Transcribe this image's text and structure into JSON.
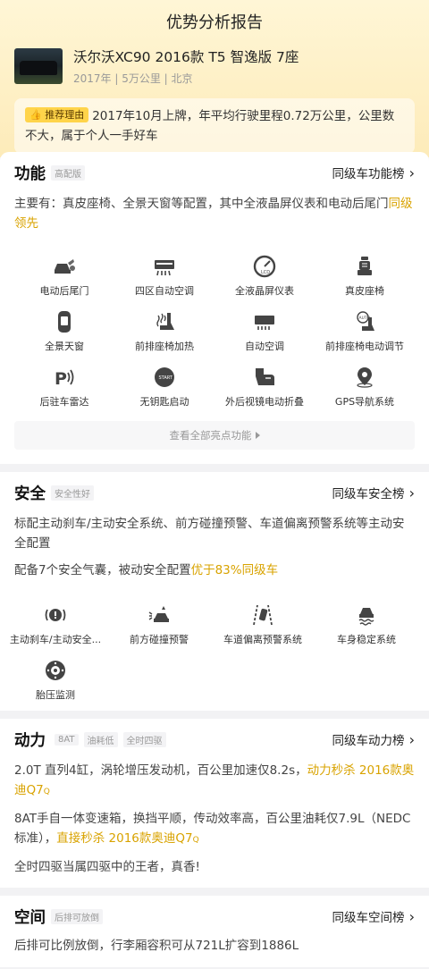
{
  "header": {
    "title": "优势分析报告"
  },
  "car": {
    "name": "沃尔沃XC90 2016款 T5 智逸版 7座",
    "meta": "2017年 | 5万公里 | 北京",
    "reason_tag": "推荐理由",
    "reason_text": "2017年10月上牌，年平均行驶里程0.72万公里，公里数不大，属于个人一手好车"
  },
  "function": {
    "title": "功能",
    "tag": "高配版",
    "link": "同级车功能榜",
    "desc_prefix": "主要有：真皮座椅、全景天窗等配置，其中全液晶屏仪表和电动后尾门",
    "desc_hl": "同级领先",
    "items": [
      {
        "label": "电动后尾门",
        "icon": "tailgate-icon"
      },
      {
        "label": "四区自动空调",
        "icon": "ac-icon"
      },
      {
        "label": "全液晶屏仪表",
        "icon": "lcd-gauge-icon"
      },
      {
        "label": "真皮座椅",
        "icon": "seat-icon"
      },
      {
        "label": "全景天窗",
        "icon": "sunroof-icon"
      },
      {
        "label": "前排座椅加热",
        "icon": "seat-heat-icon"
      },
      {
        "label": "自动空调",
        "icon": "auto-ac-icon"
      },
      {
        "label": "前排座椅电动调节",
        "icon": "auto-seat-icon"
      },
      {
        "label": "后驻车雷达",
        "icon": "parking-radar-icon"
      },
      {
        "label": "无钥匙启动",
        "icon": "start-button-icon"
      },
      {
        "label": "外后视镜电动折叠",
        "icon": "mirror-fold-icon"
      },
      {
        "label": "GPS导航系统",
        "icon": "gps-icon"
      }
    ],
    "more": "查看全部亮点功能"
  },
  "safety": {
    "title": "安全",
    "tag": "安全性好",
    "link": "同级车安全榜",
    "desc1": "标配主动刹车/主动安全系统、前方碰撞预警、车道偏离预警系统等主动安全配置",
    "desc2_prefix": "配备7个安全气囊，被动安全配置",
    "desc2_hl": "优于83%同级车",
    "items": [
      {
        "label": "主动刹车/主动安全...",
        "icon": "brake-warning-icon"
      },
      {
        "label": "前方碰撞预警",
        "icon": "collision-warning-icon"
      },
      {
        "label": "车道偏离预警系统",
        "icon": "lane-departure-icon"
      },
      {
        "label": "车身稳定系统",
        "icon": "stability-icon"
      },
      {
        "label": "胎压监测",
        "icon": "tire-pressure-icon"
      }
    ]
  },
  "power": {
    "title": "动力",
    "tags": [
      "8AT",
      "油耗低",
      "全时四驱"
    ],
    "link": "同级车动力榜",
    "desc1_prefix": "2.0T 直列4缸，涡轮增压发动机，百公里加速仅8.2s，",
    "desc1_hl": "动力秒杀 2016款奥迪Q7",
    "desc2_prefix": "8AT手自一体变速箱，换挡平顺，传动效率高，百公里油耗仅7.9L（NEDC标准），",
    "desc2_hl": "直接秒杀 2016款奥迪Q7",
    "desc3": "全时四驱当属四驱中的王者，真香!"
  },
  "space": {
    "title": "空间",
    "tag": "后排可放倒",
    "link": "同级车空间榜",
    "desc": "后排可比例放倒，行李厢容积可从721L扩容到1886L"
  },
  "colors": {
    "accent": "#d9a300",
    "hero_top": "#fff6d6",
    "hero_bottom": "#fdebb9",
    "tag_yellow": "#ffd44a"
  }
}
